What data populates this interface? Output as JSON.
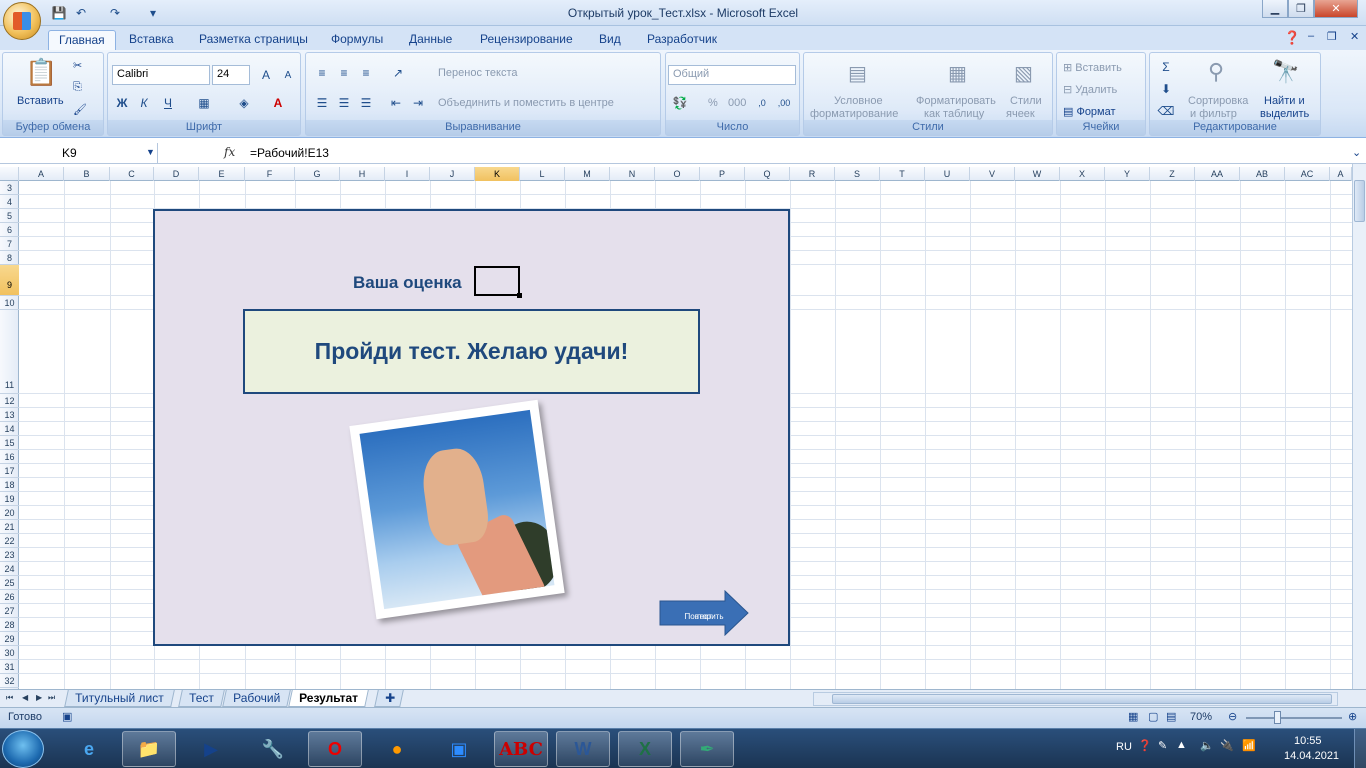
{
  "window": {
    "title": "Открытый урок_Тест.xlsx - Microsoft Excel"
  },
  "ribbon_tabs": [
    "Главная",
    "Вставка",
    "Разметка страницы",
    "Формулы",
    "Данные",
    "Рецензирование",
    "Вид",
    "Разработчик"
  ],
  "clipboard": {
    "paste": "Вставить",
    "label": "Буфер обмена"
  },
  "font": {
    "name": "Calibri",
    "size": "24",
    "bold": "Ж",
    "italic": "К",
    "underline": "Ч",
    "label": "Шрифт"
  },
  "alignment": {
    "wrap": "Перенос текста",
    "merge": "Объединить и поместить в центре",
    "label": "Выравнивание"
  },
  "number": {
    "format": "Общий",
    "percent": "%",
    "thousands": "000",
    "label": "Число"
  },
  "styles": {
    "conditional_1": "Условное",
    "conditional_2": "форматирование",
    "table_1": "Форматировать",
    "table_2": "как таблицу",
    "cell_1": "Стили",
    "cell_2": "ячеек",
    "label": "Стили"
  },
  "cells": {
    "insert": "Вставить",
    "delete": "Удалить",
    "format": "Формат",
    "label": "Ячейки"
  },
  "editing": {
    "sort_1": "Сортировка",
    "sort_2": "и фильтр",
    "find_1": "Найти и",
    "find_2": "выделить",
    "label": "Редактирование"
  },
  "formula_bar": {
    "name_box": "K9",
    "fx": "fx",
    "formula": "=Рабочий!E13"
  },
  "columns": [
    "A",
    "B",
    "C",
    "D",
    "E",
    "F",
    "G",
    "H",
    "I",
    "J",
    "K",
    "L",
    "M",
    "N",
    "O",
    "P",
    "Q",
    "R",
    "S",
    "T",
    "U",
    "V",
    "W",
    "X",
    "Y",
    "Z",
    "AA",
    "AB",
    "AC",
    "A"
  ],
  "selected_column": "K",
  "rows": [
    "3",
    "4",
    "5",
    "6",
    "7",
    "8",
    "9",
    "10",
    "11",
    "12",
    "13",
    "14",
    "15",
    "16",
    "17",
    "18",
    "19",
    "20",
    "21",
    "22",
    "23",
    "24",
    "25",
    "26",
    "27",
    "28",
    "29",
    "30",
    "31",
    "32"
  ],
  "selected_row": "9",
  "sheet": {
    "grade_label": "Ваша оценка",
    "banner": "Пройди тест. Желаю удачи!",
    "repeat_line1": "Повторить",
    "repeat_line2": "тест"
  },
  "sheet_tabs": [
    "Титульный лист",
    "Тест",
    "Рабочий",
    "Результат"
  ],
  "active_sheet": "Результат",
  "status": {
    "ready": "Готово",
    "zoom": "70%"
  },
  "tray": {
    "lang": "RU",
    "time": "10:55",
    "date": "14.04.2021"
  },
  "colors": {
    "panel": "#e5e0ec",
    "banner": "#ebf1de",
    "accent": "#1f497d"
  }
}
